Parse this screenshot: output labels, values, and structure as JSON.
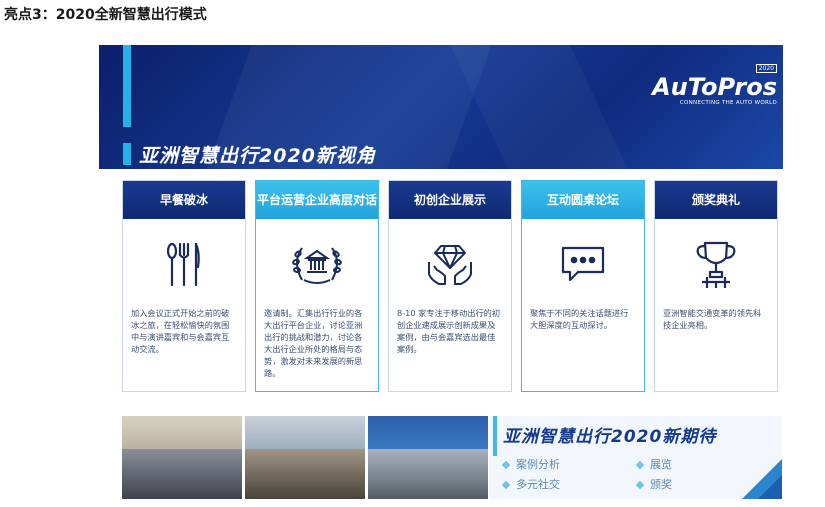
{
  "heading": "亮点3：2020全新智慧出行模式",
  "banner": {
    "title": "亚洲智慧出行2020新视角",
    "logo": {
      "badge": "2020",
      "name": "AuToPros",
      "tagline": "CONNECTING THE AUTO WORLD"
    }
  },
  "cards": [
    {
      "title": "早餐破冰",
      "icon": "cutlery-icon",
      "text": "加入会议正式开始之前的破冰之旅，在轻松愉快的氛围中与演讲嘉宾和与会嘉宾互动交流。",
      "highlighted": false
    },
    {
      "title": "平台运营企业高层对话",
      "icon": "laurel-building-icon",
      "text": "邀请制。汇集出行行业的各大出行平台企业，讨论亚洲出行的挑战和潜力，讨论各大出行企业所处的格局与态势，激发对未来发展的新思路。",
      "highlighted": true
    },
    {
      "title": "初创企业展示",
      "icon": "diamond-hands-icon",
      "text": "8-10 家专注于移动出行的初创企业速成展示创新成果及案例，由与会嘉宾选出最佳案例。",
      "highlighted": false
    },
    {
      "title": "互动圆桌论坛",
      "icon": "chat-bubble-icon",
      "text": "聚焦于不同的关注话题进行大胆深度的互动探讨。",
      "highlighted": true
    },
    {
      "title": "颁奖典礼",
      "icon": "trophy-icon",
      "text": "亚洲智能交通变革的领先科技企业亮相。",
      "highlighted": false
    }
  ],
  "expect": {
    "title": "亚洲智慧出行2020新期待",
    "items": [
      "案例分析",
      "展览",
      "多元社交",
      "颁奖"
    ]
  },
  "colors": {
    "navy": "#0f2a73",
    "cyan": "#22a3dc",
    "text": "#3b4e73"
  }
}
